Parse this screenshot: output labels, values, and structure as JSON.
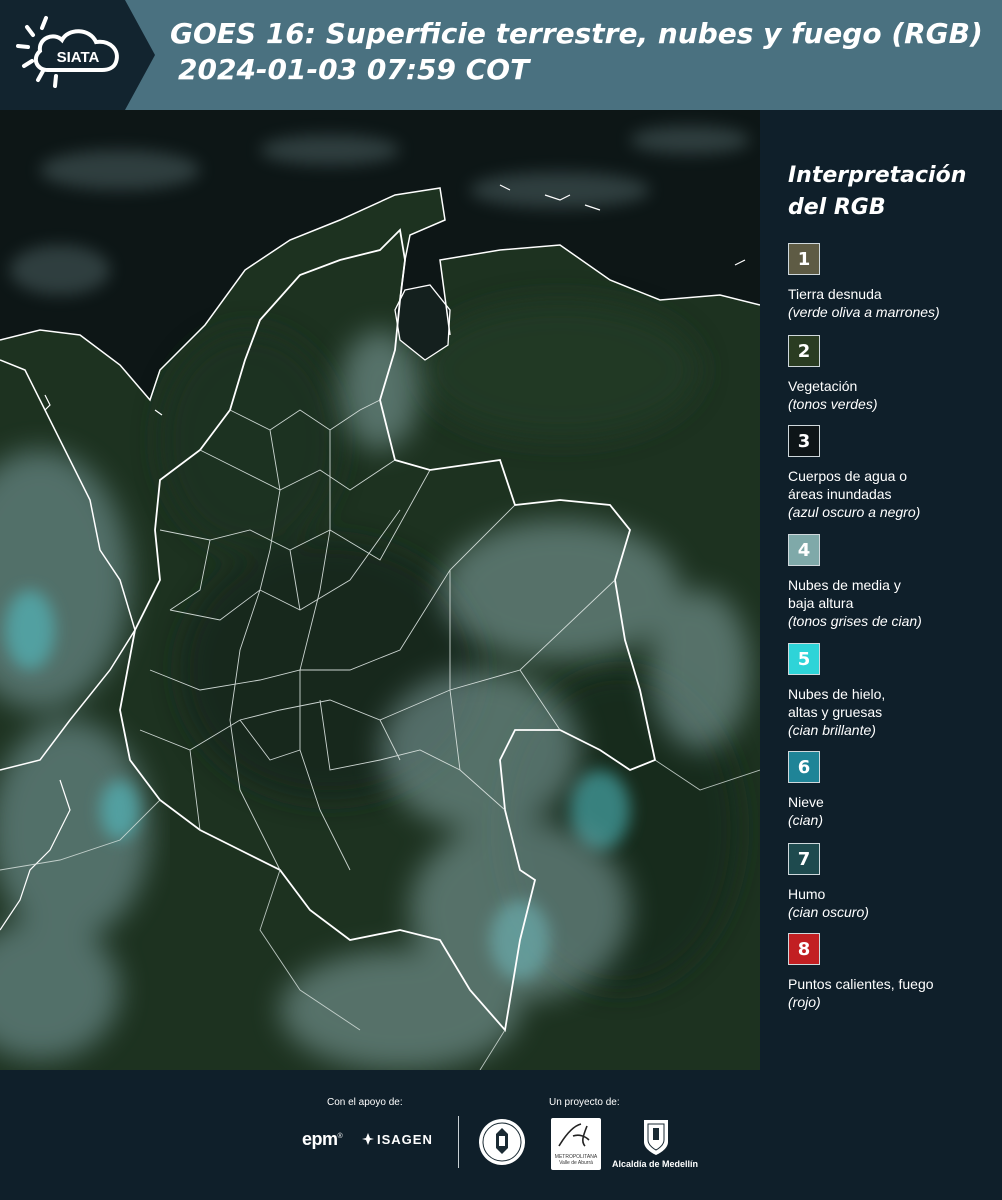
{
  "header": {
    "logo_text": "SIATA",
    "title_line1": "GOES 16: Superficie terrestre, nubes y fuego (RGB)",
    "title_line2": "2024-01-03 07:59 COT"
  },
  "legend": {
    "title_line1": "Interpretación",
    "title_line2": "del RGB",
    "items": [
      {
        "num": "1",
        "color": "#5e5b44",
        "label_lines": [
          "Tierra desnuda"
        ],
        "note": "(verde oliva a marrones)"
      },
      {
        "num": "2",
        "color": "#2a3c22",
        "label_lines": [
          "Vegetación"
        ],
        "note": "(tonos verdes)"
      },
      {
        "num": "3",
        "color": "#0e1518",
        "label_lines": [
          "Cuerpos de agua o",
          "áreas inundadas"
        ],
        "note": "(azul oscuro a negro)"
      },
      {
        "num": "4",
        "color": "#7fa9a9",
        "label_lines": [
          "Nubes de media y",
          "baja altura"
        ],
        "note": "(tonos grises de cian)"
      },
      {
        "num": "5",
        "color": "#2ed4d8",
        "label_lines": [
          "Nubes de hielo,",
          "altas y gruesas"
        ],
        "note": "(cian brillante)"
      },
      {
        "num": "6",
        "color": "#1f8497",
        "label_lines": [
          "Nieve"
        ],
        "note": "(cian)"
      },
      {
        "num": "7",
        "color": "#1e4a4e",
        "label_lines": [
          "Humo"
        ],
        "note": "(cian oscuro)"
      },
      {
        "num": "8",
        "color": "#c21f22",
        "label_lines": [
          "Puntos calientes, fuego"
        ],
        "note": "(rojo)"
      }
    ]
  },
  "footer": {
    "support_label": "Con el apoyo de:",
    "project_label": "Un proyecto de:",
    "sponsor_1": "epm",
    "sponsor_2": "ISAGEN",
    "area_caption_1": "METROPOLITANA",
    "area_caption_2": "Valle de Aburrá",
    "alcaldia": "Alcaldía de Medellín"
  },
  "colors": {
    "header_bg": "#4a7180",
    "page_bg": "#0f1f2a",
    "map_land": "#1e3320",
    "map_cloud": "#9fbcbc"
  }
}
